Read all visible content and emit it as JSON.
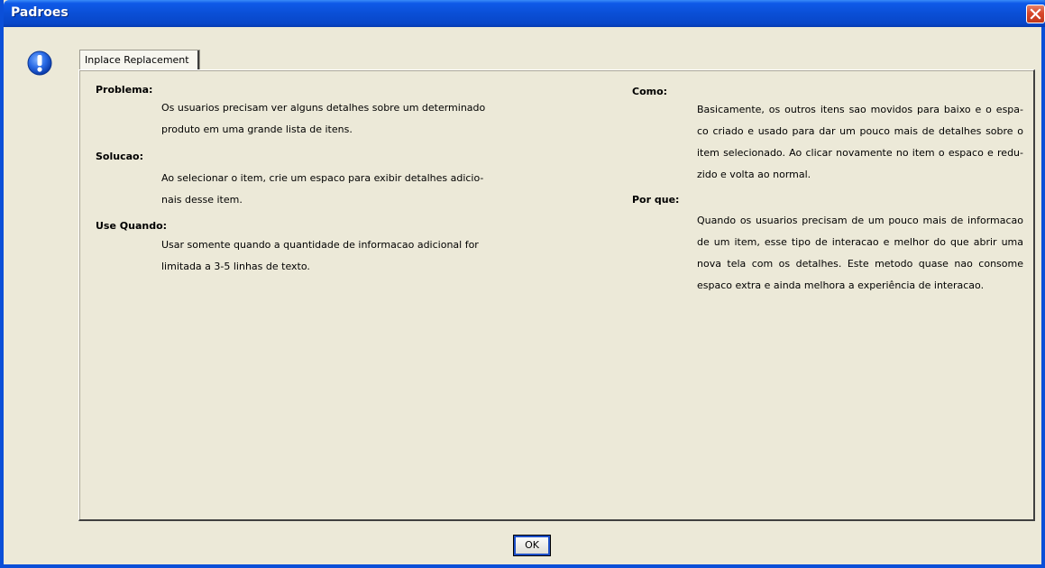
{
  "window": {
    "title": "Padroes",
    "accent": "#0a4fd6",
    "close_color": "#d8482a"
  },
  "icons": {
    "info": "info-exclamation-icon",
    "close": "close-icon"
  },
  "tab": {
    "label": "Inplace Replacement"
  },
  "left": {
    "problema": {
      "heading": "Problema:",
      "lines": [
        "Os usuarios precisam ver alguns detalhes sobre um determinado",
        "produto em uma grande lista de itens."
      ]
    },
    "solucao": {
      "heading": "Solucao:",
      "lines": [
        "Ao selecionar o item, crie um espaco para exibir detalhes adicio-",
        "nais desse item."
      ]
    },
    "use_quando": {
      "heading": "Use Quando:",
      "lines": [
        "Usar somente quando a quantidade de informacao adicional  for",
        "limitada a 3-5 linhas de texto."
      ]
    }
  },
  "right": {
    "como": {
      "heading": "Como:",
      "lines": [
        "Basicamente, os outros itens sao movidos  para baixo e o espa-",
        "co criado e usado para dar um pouco mais de detalhes  sobre  o",
        "item selecionado. Ao clicar novamente no item o espaco e redu-",
        "zido e volta ao normal."
      ]
    },
    "por_que": {
      "heading": "Por que:",
      "lines": [
        "Quando os usuarios precisam de um pouco mais  de  informacao",
        "de um item, esse tipo de interacao e melhor  do  que  abrir  uma",
        "nova tela com os detalhes.  Este metodo quase nao consome",
        "espaco extra e ainda melhora a experiência de interacao."
      ]
    }
  },
  "buttons": {
    "ok": "OK"
  }
}
